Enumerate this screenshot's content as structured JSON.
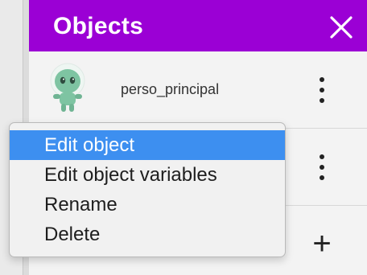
{
  "panel": {
    "title": "Objects",
    "close_icon": "close-icon",
    "header_color": "#9b00d5"
  },
  "objects": [
    {
      "name": "perso_principal",
      "icon": "alien-character-icon"
    },
    {
      "name": "",
      "icon": ""
    }
  ],
  "add_label": "+",
  "context_menu": {
    "items": [
      {
        "label": "Edit object",
        "highlighted": true
      },
      {
        "label": "Edit object variables",
        "highlighted": false
      },
      {
        "label": "Rename",
        "highlighted": false
      },
      {
        "label": "Delete",
        "highlighted": false
      }
    ],
    "highlight_color": "#3d8ff0"
  }
}
